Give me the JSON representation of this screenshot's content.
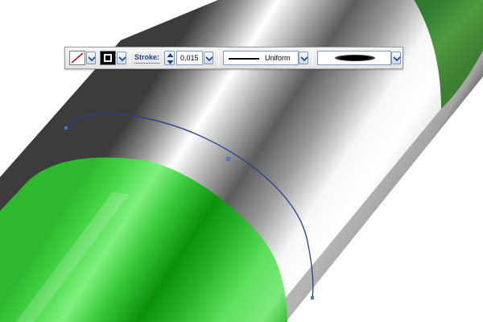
{
  "canvas": {
    "object": "green-cylinder-with-chrome-band",
    "colors": {
      "green_light": "#6ee36e",
      "green_mid": "#2fbf2f",
      "green_dark": "#0e8f0e",
      "chrome_light": "#ffffff",
      "chrome_dark": "#4a4a4a",
      "path_stroke": "#2b3f8f",
      "anchor_point": "#4a78c8"
    }
  },
  "control_bar": {
    "fill_icon": "fill-none-swatch-icon",
    "stroke_icon": "stroke-black-swatch-icon",
    "stroke_label": "Stroke:",
    "stroke_weight": "0,015",
    "variable_width_profile": "Uniform",
    "brush_definition_icon": "basic-brush-ellipse-icon",
    "dropdown_icon": "chevron-down-icon",
    "spinner_icon": "spinner-arrows-icon"
  }
}
